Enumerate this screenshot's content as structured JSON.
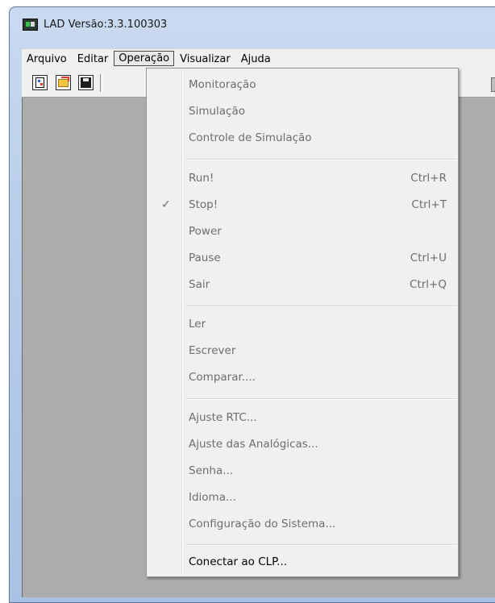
{
  "window": {
    "title": "LAD Versão:3.3.100303"
  },
  "menubar": {
    "items": [
      "Arquivo",
      "Editar",
      "Operação",
      "Visualizar",
      "Ajuda"
    ],
    "active": "Operação"
  },
  "toolbar": {
    "buttons": [
      "new-file-icon",
      "open-folder-icon",
      "save-disk-icon"
    ]
  },
  "dropdown": {
    "items": [
      {
        "label": "Monitoração",
        "shortcut": "",
        "enabled": false,
        "checked": false
      },
      {
        "label": "Simulação",
        "shortcut": "",
        "enabled": false,
        "checked": false
      },
      {
        "label": "Controle de Simulação",
        "shortcut": "",
        "enabled": false,
        "checked": false
      },
      {
        "label": "Run!",
        "shortcut": "Ctrl+R",
        "enabled": false,
        "checked": false
      },
      {
        "label": "Stop!",
        "shortcut": "Ctrl+T",
        "enabled": false,
        "checked": true
      },
      {
        "label": "Power",
        "shortcut": "",
        "enabled": false,
        "checked": false
      },
      {
        "label": "Pause",
        "shortcut": "Ctrl+U",
        "enabled": false,
        "checked": false
      },
      {
        "label": "Sair",
        "shortcut": "Ctrl+Q",
        "enabled": false,
        "checked": false
      },
      {
        "label": "Ler",
        "shortcut": "",
        "enabled": false,
        "checked": false
      },
      {
        "label": "Escrever",
        "shortcut": "",
        "enabled": false,
        "checked": false
      },
      {
        "label": "Comparar....",
        "shortcut": "",
        "enabled": false,
        "checked": false
      },
      {
        "label": "Ajuste RTC...",
        "shortcut": "",
        "enabled": false,
        "checked": false
      },
      {
        "label": "Ajuste das Analógicas...",
        "shortcut": "",
        "enabled": false,
        "checked": false
      },
      {
        "label": "Senha...",
        "shortcut": "",
        "enabled": false,
        "checked": false
      },
      {
        "label": "Idioma...",
        "shortcut": "",
        "enabled": false,
        "checked": false
      },
      {
        "label": "Configuração do Sistema...",
        "shortcut": "",
        "enabled": false,
        "checked": false
      },
      {
        "label": "Conectar ao CLP...",
        "shortcut": "",
        "enabled": true,
        "checked": false
      }
    ],
    "check_glyph": "✓"
  },
  "colors": {
    "disabled_text": "#6d6d6d",
    "enabled_text": "#000000",
    "menu_bg": "#f0f0f0",
    "client_bg": "#acacac"
  }
}
